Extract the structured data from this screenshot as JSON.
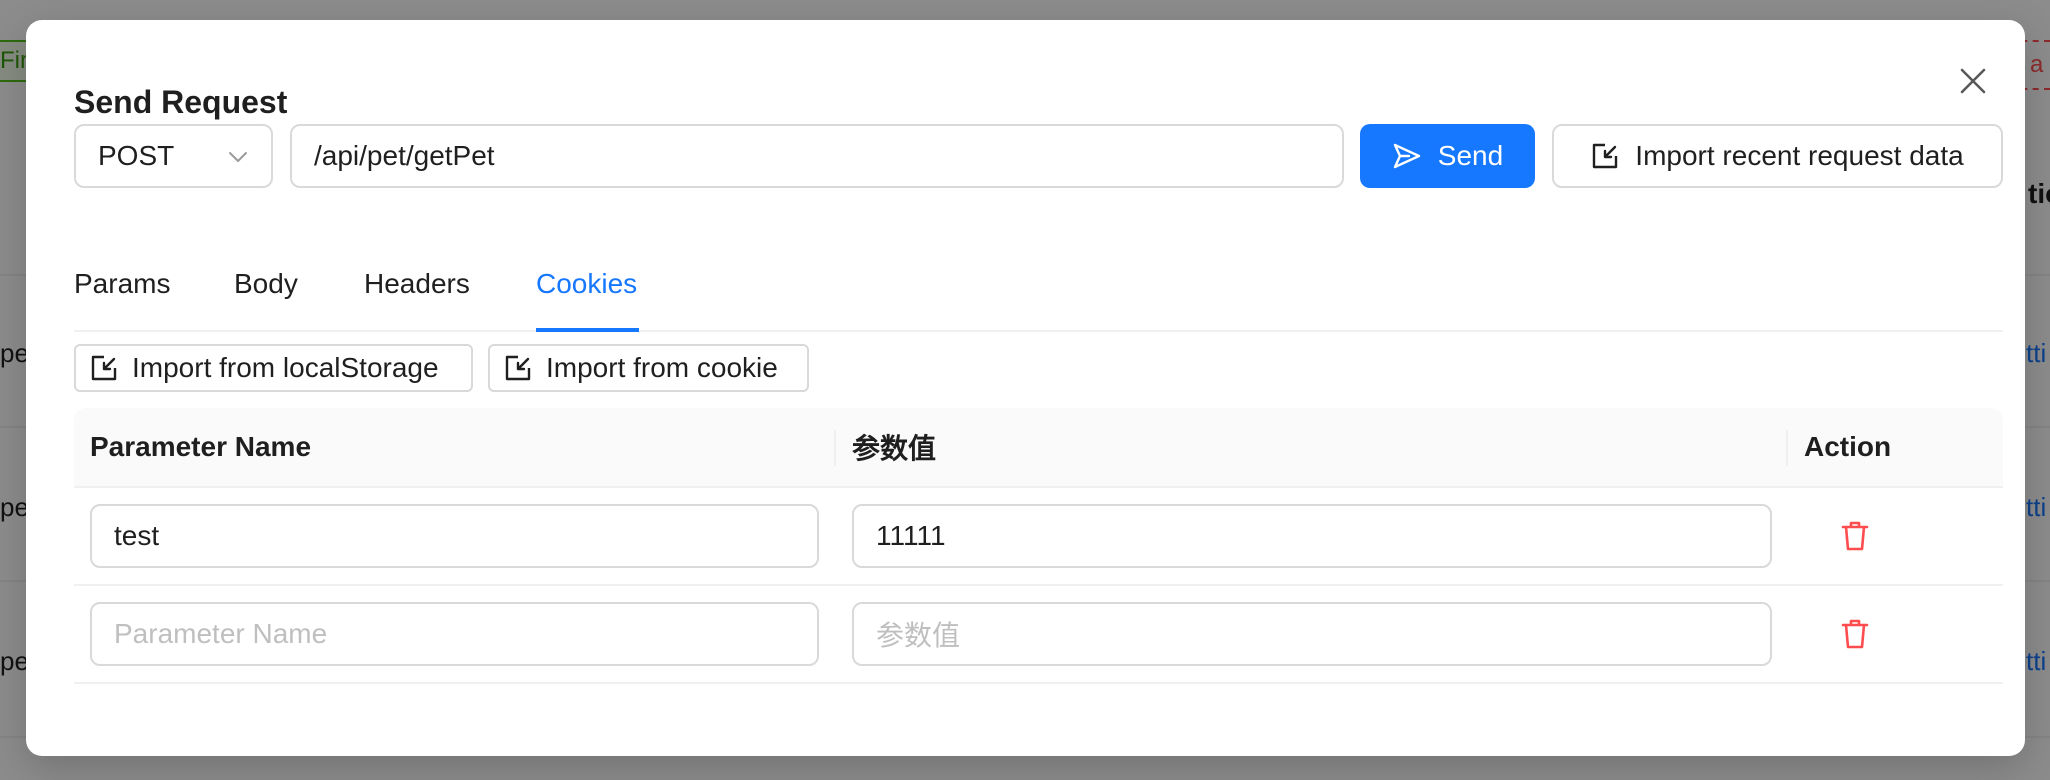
{
  "background": {
    "tag_left": "Firs",
    "tag_right": "a",
    "header_right": "tio",
    "rows": [
      {
        "left": "pe",
        "right": "tti"
      },
      {
        "left": "pe",
        "right": "tti"
      },
      {
        "left": "pe",
        "right": "tti"
      }
    ]
  },
  "modal": {
    "title": "Send Request",
    "close_icon": "close-icon"
  },
  "request": {
    "method": "POST",
    "url": "/api/pet/getPet",
    "send_label": "Send",
    "import_recent_label": "Import recent request data",
    "send_icon": "send-icon",
    "import_icon": "import-icon"
  },
  "tabs": [
    {
      "label": "Params",
      "active": false
    },
    {
      "label": "Body",
      "active": false
    },
    {
      "label": "Headers",
      "active": false
    },
    {
      "label": "Cookies",
      "active": true
    }
  ],
  "cookies": {
    "import_local_storage_label": "Import from localStorage",
    "import_cookie_label": "Import from cookie",
    "columns": [
      "Parameter Name",
      "参数值",
      "Action"
    ],
    "rows": [
      {
        "name": "test",
        "value": "11111"
      },
      {
        "name": "",
        "value": ""
      }
    ],
    "name_placeholder": "Parameter Name",
    "value_placeholder": "参数值",
    "delete_icon": "trash-icon"
  },
  "colors": {
    "primary": "#1677ff",
    "danger": "#ff4d4f",
    "border": "#d9d9d9"
  }
}
